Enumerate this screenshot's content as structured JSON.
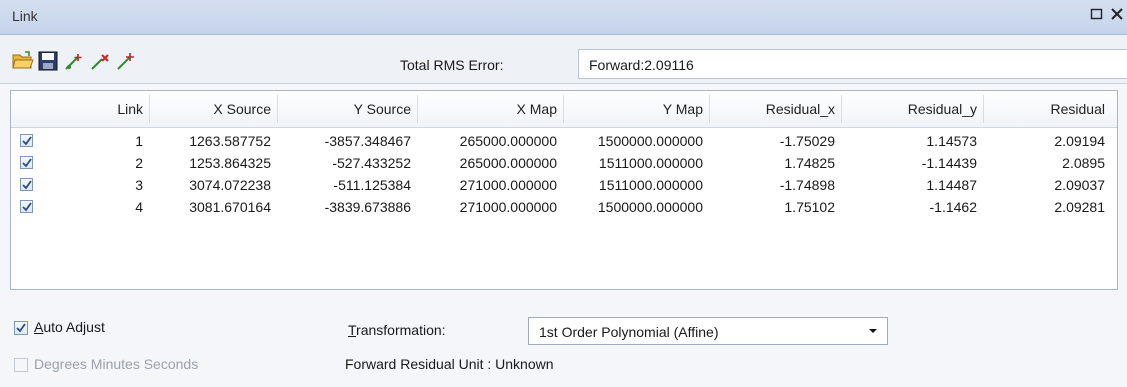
{
  "window": {
    "title": "Link",
    "restore_icon": "restore-icon",
    "close_icon": "close-icon"
  },
  "toolbar": {
    "icons": [
      "open-folder-icon",
      "save-icon",
      "auto-register-icon",
      "delete-link-icon",
      "add-link-icon"
    ],
    "rms_label": "Total RMS Error:",
    "rms_value": "Forward:2.09116"
  },
  "table": {
    "columns": [
      "Link",
      "X Source",
      "Y Source",
      "X Map",
      "Y Map",
      "Residual_x",
      "Residual_y",
      "Residual"
    ],
    "rows": [
      {
        "checked": true,
        "link": "1",
        "x_source": "1263.587752",
        "y_source": "-3857.348467",
        "x_map": "265000.000000",
        "y_map": "1500000.000000",
        "residual_x": "-1.75029",
        "residual_y": "1.14573",
        "residual": "2.09194"
      },
      {
        "checked": true,
        "link": "2",
        "x_source": "1253.864325",
        "y_source": "-527.433252",
        "x_map": "265000.000000",
        "y_map": "1511000.000000",
        "residual_x": "1.74825",
        "residual_y": "-1.14439",
        "residual": "2.0895"
      },
      {
        "checked": true,
        "link": "3",
        "x_source": "3074.072238",
        "y_source": "-511.125384",
        "x_map": "271000.000000",
        "y_map": "1511000.000000",
        "residual_x": "-1.74898",
        "residual_y": "1.14487",
        "residual": "2.09037"
      },
      {
        "checked": true,
        "link": "4",
        "x_source": "3081.670164",
        "y_source": "-3839.673886",
        "x_map": "271000.000000",
        "y_map": "1500000.000000",
        "residual_x": "1.75102",
        "residual_y": "-1.1462",
        "residual": "2.09281"
      }
    ]
  },
  "options": {
    "auto_adjust": {
      "label_prefix": "",
      "label_underlined": "A",
      "label_rest": "uto Adjust",
      "checked": true
    },
    "dms": {
      "label": "Degrees Minutes Seconds",
      "checked": false,
      "enabled": false
    },
    "transformation_label_underlined": "T",
    "transformation_label_rest": "ransformation:",
    "transformation_value": "1st Order Polynomial (Affine)",
    "residual_unit": "Forward Residual Unit : Unknown"
  }
}
